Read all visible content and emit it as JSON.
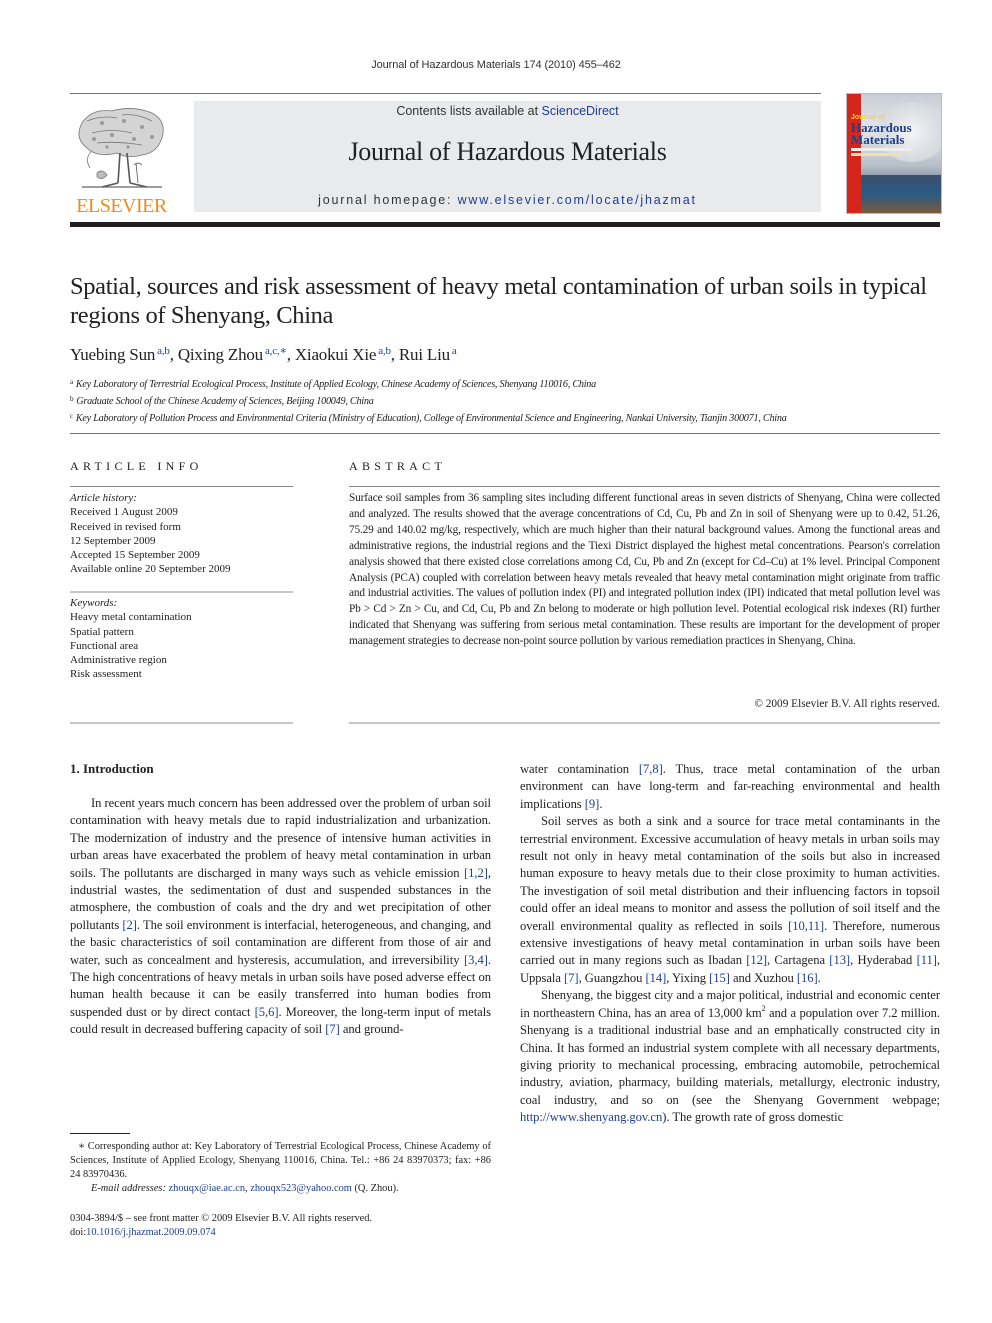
{
  "running_head": "Journal of Hazardous Materials 174 (2010) 455–462",
  "publisher": {
    "logo_text": "ELSEVIER",
    "contents_prefix": "Contents lists available at ",
    "contents_link": "ScienceDirect",
    "journal_title": "Journal of Hazardous Materials",
    "homepage_prefix": "journal homepage: ",
    "homepage_link": "www.elsevier.com/locate/jhazmat",
    "cover": {
      "kicker": "Journal of",
      "title_line1": "Hazardous",
      "title_line2": "Materials",
      "brand_red": "#d6261c",
      "title_blue": "#1e3f8a"
    },
    "logo_orange": "#f08a1d",
    "link_blue": "#1f3d99"
  },
  "article": {
    "title": "Spatial, sources and risk assessment of heavy metal contamination of urban soils in typical regions of Shenyang, China",
    "authors": [
      {
        "name": "Yuebing Sun",
        "sup": "a,b",
        "sep": ", "
      },
      {
        "name": "Qixing Zhou",
        "sup": "a,c,∗",
        "sep": ", "
      },
      {
        "name": "Xiaokui Xie",
        "sup": "a,b",
        "sep": ", "
      },
      {
        "name": "Rui Liu",
        "sup": "a",
        "sep": ""
      }
    ],
    "affiliations": [
      {
        "mark": "a",
        "text": "Key Laboratory of Terrestrial Ecological Process, Institute of Applied Ecology, Chinese Academy of Sciences, Shenyang 110016, China"
      },
      {
        "mark": "b",
        "text": "Graduate School of the Chinese Academy of Sciences, Beijing 100049, China"
      },
      {
        "mark": "c",
        "text": "Key Laboratory of Pollution Process and Environmental Criteria (Ministry of Education), College of Environmental Science and Engineering, Nankai University, Tianjin 300071, China"
      }
    ]
  },
  "article_info": {
    "heading": "ARTICLE INFO",
    "history_label": "Article history:",
    "history": [
      "Received 1 August 2009",
      "Received in revised form",
      "12 September 2009",
      "Accepted 15 September 2009",
      "Available online 20 September 2009"
    ],
    "keywords_label": "Keywords:",
    "keywords": [
      "Heavy metal contamination",
      "Spatial pattern",
      "Functional area",
      "Administrative region",
      "Risk assessment"
    ]
  },
  "abstract": {
    "heading": "ABSTRACT",
    "text": "Surface soil samples from 36 sampling sites including different functional areas in seven districts of Shenyang, China were collected and analyzed. The results showed that the average concentrations of Cd, Cu, Pb and Zn in soil of Shenyang were up to 0.42, 51.26, 75.29 and 140.02 mg/kg, respectively, which are much higher than their natural background values. Among the functional areas and administrative regions, the industrial regions and the Tiexi District displayed the highest metal concentrations. Pearson's correlation analysis showed that there existed close correlations among Cd, Cu, Pb and Zn (except for Cd–Cu) at 1% level. Principal Component Analysis (PCA) coupled with correlation between heavy metals revealed that heavy metal contamination might originate from traffic and industrial activities. The values of pollution index (PI) and integrated pollution index (IPI) indicated that metal pollution level was Pb > Cd > Zn > Cu, and Cd, Cu, Pb and Zn belong to moderate or high pollution level. Potential ecological risk indexes (RI) further indicated that Shenyang was suffering from serious metal contamination. These results are important for the development of proper management strategies to decrease non-point source pollution by various remediation practices in Shenyang, China.",
    "copyright": "© 2009 Elsevier B.V. All rights reserved."
  },
  "intro": {
    "heading": "1.  Introduction",
    "p1": [
      {
        "t": "In recent years much concern has been addressed over the problem of urban soil contamination with heavy metals due to rapid industrialization and urbanization. The modernization of industry and the presence of intensive human activities in urban areas have exacerbated the problem of heavy metal contamination in urban soils. The pollutants are discharged in many ways such as vehicle emission "
      },
      {
        "ref": "[1,2]"
      },
      {
        "t": ", industrial wastes, the sedimentation of dust and suspended substances in the atmosphere, the combustion of coals and the dry and wet precipitation of other pollutants "
      },
      {
        "ref": "[2]"
      },
      {
        "t": ". The soil environment is interfacial, heterogeneous, and changing, and the basic characteristics of soil contamination are different from those of air and water, such as concealment and hysteresis, accumulation, and irreversibility "
      },
      {
        "ref": "[3,4]"
      },
      {
        "t": ". The high concentrations of heavy metals in urban soils have posed adverse effect on human health because it can be easily transferred into human bodies from suspended dust or by direct contact "
      },
      {
        "ref": "[5,6]"
      },
      {
        "t": ". Moreover, the long-term input of metals could result in decreased buffering capacity of soil "
      },
      {
        "ref": "[7]"
      },
      {
        "t": " and ground-"
      }
    ],
    "p1_cont": [
      {
        "t": "water contamination "
      },
      {
        "ref": "[7,8]"
      },
      {
        "t": ". Thus, trace metal contamination of the urban environment can have long-term and far-reaching environmental and health implications "
      },
      {
        "ref": "[9]"
      },
      {
        "t": "."
      }
    ],
    "p2": [
      {
        "t": "Soil serves as both a sink and a source for trace metal contaminants in the terrestrial environment. Excessive accumulation of heavy metals in urban soils may result not only in heavy metal contamination of the soils but also in increased human exposure to heavy metals due to their close proximity to human activities. The investigation of soil metal distribution and their influencing factors in topsoil could offer an ideal means to monitor and assess the pollution of soil itself and the overall environmental quality as reflected in soils "
      },
      {
        "ref": "[10,11]"
      },
      {
        "t": ". Therefore, numerous extensive investigations of heavy metal contamination in urban soils have been carried out in many regions such as Ibadan "
      },
      {
        "ref": "[12]"
      },
      {
        "t": ", Cartagena "
      },
      {
        "ref": "[13]"
      },
      {
        "t": ", Hyderabad "
      },
      {
        "ref": "[11]"
      },
      {
        "t": ", Uppsala "
      },
      {
        "ref": "[7]"
      },
      {
        "t": ", Guangzhou "
      },
      {
        "ref": "[14]"
      },
      {
        "t": ", Yixing "
      },
      {
        "ref": "[15]"
      },
      {
        "t": " and Xuzhou "
      },
      {
        "ref": "[16]"
      },
      {
        "t": "."
      }
    ],
    "p3": [
      {
        "t": "Shenyang, the biggest city and a major political, industrial and economic center in northeastern China, has an area of 13,000 km"
      },
      {
        "sup": "2"
      },
      {
        "t": " and a population over 7.2 million. Shenyang is a traditional industrial base and an emphatically constructed city in China. It has formed an industrial system complete with all necessary departments, giving priority to mechanical processing, embracing automobile, petrochemical industry, aviation, pharmacy, building materials, metallurgy, electronic industry, coal industry, and so on (see the Shenyang Government webpage; "
      },
      {
        "ref": "http://www.shenyang.gov.cn"
      },
      {
        "t": "). The growth rate of gross domestic"
      }
    ]
  },
  "footnote": {
    "corresponding": "∗  Corresponding author at: Key Laboratory of Terrestrial Ecological Process, Chinese Academy of Sciences, Institute of Applied Ecology, Shenyang 110016, China. Tel.: +86 24 83970373; fax: +86 24 83970436.",
    "email_label": "E-mail addresses:",
    "email1": "zhouqx@iae.ac.cn",
    "email_sep": ", ",
    "email2": "zhouqx523@yahoo.com",
    "email_suffix": " (Q. Zhou)."
  },
  "front_matter": {
    "issn_line": "0304-3894/$ – see front matter © 2009 Elsevier B.V. All rights reserved.",
    "doi_prefix": "doi:",
    "doi": "10.1016/j.jhazmat.2009.09.074"
  }
}
